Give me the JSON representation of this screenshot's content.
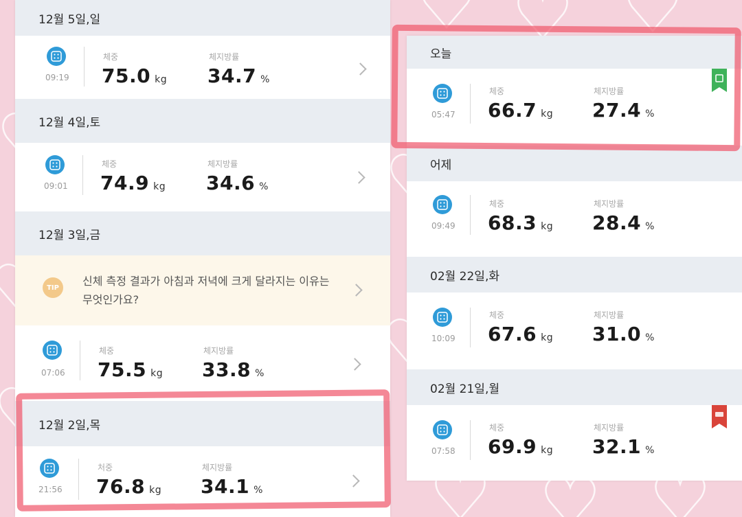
{
  "labels": {
    "weight": "체중",
    "fat": "체지방률",
    "weight_alt": "처중"
  },
  "units": {
    "weight": "kg",
    "fat": "%"
  },
  "left_panel": {
    "days": [
      {
        "date": "12월 5일,일",
        "time": "09:19",
        "weight": "75.0",
        "fat": "34.7"
      },
      {
        "date": "12월 4일,토",
        "time": "09:01",
        "weight": "74.9",
        "fat": "34.6"
      },
      {
        "date": "12월 3일,금",
        "time": "07:06",
        "weight": "75.5",
        "fat": "33.8"
      },
      {
        "date": "12월 2일,목",
        "time": "21:56",
        "weight": "76.8",
        "fat": "34.1"
      }
    ],
    "tip": {
      "badge": "TIP",
      "text": "신체 측정 결과가 아침과 저녁에 크게 달라지는 이유는 무엇인가요?"
    }
  },
  "right_panel": {
    "days": [
      {
        "date": "오늘",
        "time": "05:47",
        "weight": "66.7",
        "fat": "27.4",
        "ribbon": "green"
      },
      {
        "date": "어제",
        "time": "09:49",
        "weight": "68.3",
        "fat": "28.4"
      },
      {
        "date": "02월 22일,화",
        "time": "10:09",
        "weight": "67.6",
        "fat": "31.0"
      },
      {
        "date": "02월 21일,월",
        "time": "07:58",
        "weight": "69.9",
        "fat": "32.1",
        "ribbon": "red"
      }
    ]
  },
  "colors": {
    "icon_blue": "#2f9bd8",
    "highlight": "#f05a6e",
    "ribbon_green": "#3fb25a",
    "ribbon_red": "#d9443a"
  }
}
